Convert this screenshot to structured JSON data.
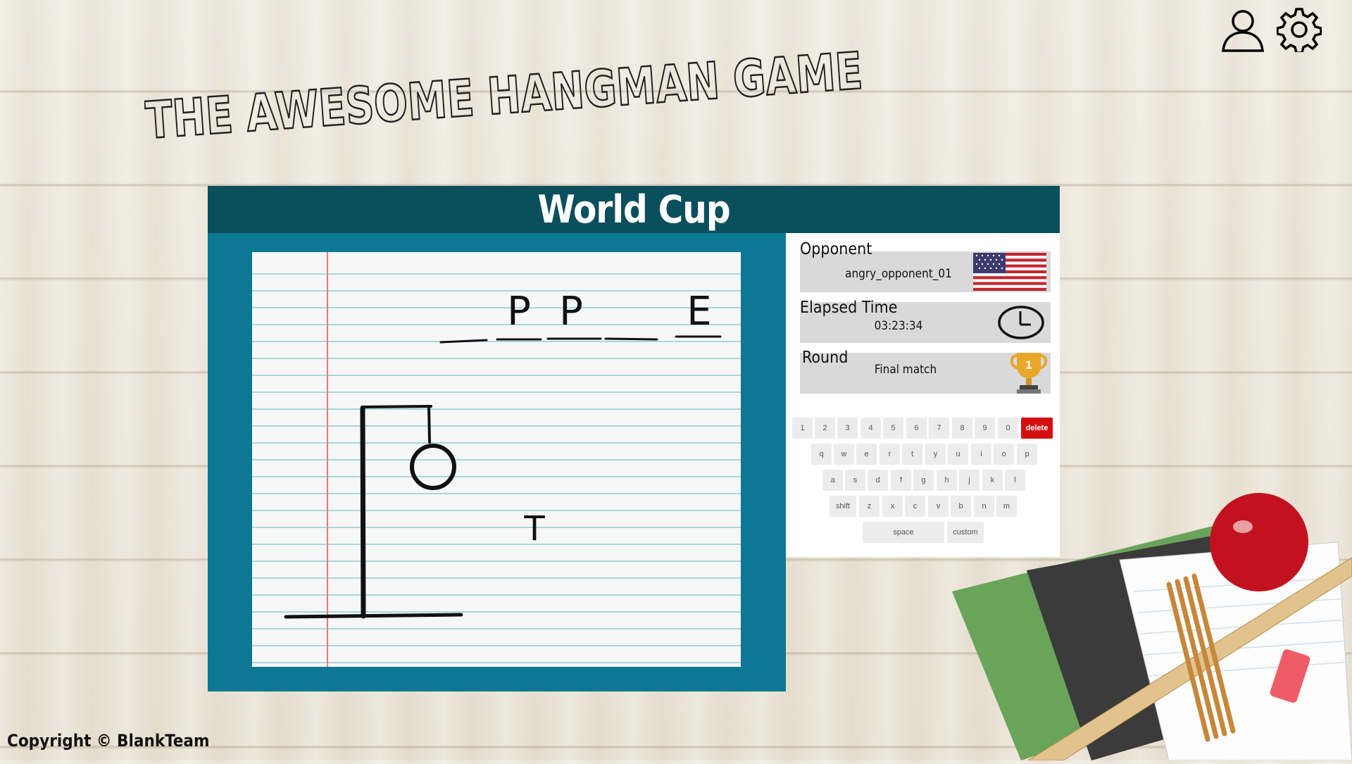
{
  "header": {
    "game_title": "THE AWESOME HANGMAN GAME"
  },
  "icons": {
    "profile": "user-icon",
    "settings": "gear-icon"
  },
  "category": "World Cup",
  "puzzle": {
    "slots": [
      "",
      "P",
      "P",
      "",
      "E"
    ],
    "misses": [
      "T"
    ],
    "wrong_guess_count": 1
  },
  "info": {
    "opponent_label": "Opponent",
    "opponent_name": "angry_opponent_01",
    "opponent_flag": "us-flag-icon",
    "time_label": "Elapsed Time",
    "time_value": "03:23:34",
    "round_label": "Round",
    "round_value": "Final match",
    "trophy_number": "1"
  },
  "keyboard": {
    "row1": [
      "1",
      "2",
      "3",
      "4",
      "5",
      "6",
      "7",
      "8",
      "9",
      "0",
      "delete"
    ],
    "row2": [
      "q",
      "w",
      "e",
      "r",
      "t",
      "y",
      "u",
      "i",
      "o",
      "p"
    ],
    "row3": [
      "a",
      "s",
      "d",
      "f",
      "g",
      "h",
      "j",
      "k",
      "l"
    ],
    "row4": [
      "shift",
      "z",
      "x",
      "c",
      "v",
      "b",
      "n",
      "m"
    ],
    "row5": [
      "space",
      "custom"
    ]
  },
  "footer": {
    "copyright": "Copyright © BlankTeam"
  },
  "colors": {
    "header_bg": "#0b4f5c",
    "play_bg": "#0d7893",
    "delete_key": "#d50f11"
  }
}
